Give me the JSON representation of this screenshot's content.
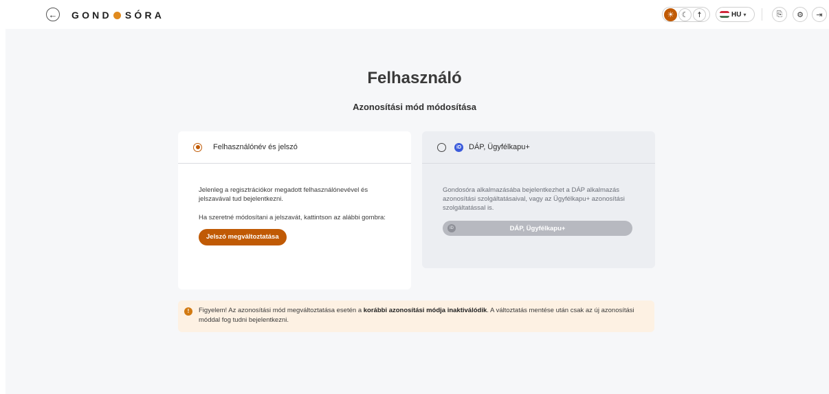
{
  "header": {
    "back_icon": "arrow-left-icon",
    "logo_left": "GOND",
    "logo_right": "SÓRA",
    "theme_icons": [
      "sun-icon",
      "moon-icon",
      "accessibility-icon"
    ],
    "language": "HU",
    "action_icons": [
      "export-icon",
      "settings-icon",
      "logout-icon"
    ]
  },
  "main": {
    "title": "Felhasználó",
    "subtitle": "Azonosítási mód módosítása"
  },
  "option_password": {
    "label": "Felhasználónév és jelszó",
    "selected": true,
    "text1": "Jelenleg a regisztrációkor megadott felhasználónevével és jelszavával tud bejelentkezni.",
    "text2": "Ha szeretné módosítani a jelszavát, kattintson az alábbi gombra:",
    "button": "Jelszó megváltoztatása"
  },
  "option_dap": {
    "label": "DÁP, Ügyfélkapu+",
    "selected": false,
    "badge": "iD",
    "text": "Gondosóra alkalmazásába bejelentkezhet a DÁP alkalmazás azonosítási szolgáltatásaival, vagy az Ügyfélkapu+ azonosítási szolgáltatással is.",
    "button": "DÁP, Ügyfélkapu+"
  },
  "warning": {
    "icon": "warning-icon",
    "part1": "Figyelem! Az azonosítási mód megváltoztatása esetén a ",
    "bold": "korábbi azonosítási módja inaktiválódik",
    "part2": ". A változtatás mentése után csak az új azonosítási móddal fog tudni bejelentkezni."
  },
  "colors": {
    "accent": "#c05a05",
    "logo_dot": "#e08a1e",
    "warning_bg": "#fdf1e3",
    "id_badge": "#3b5bdb"
  }
}
